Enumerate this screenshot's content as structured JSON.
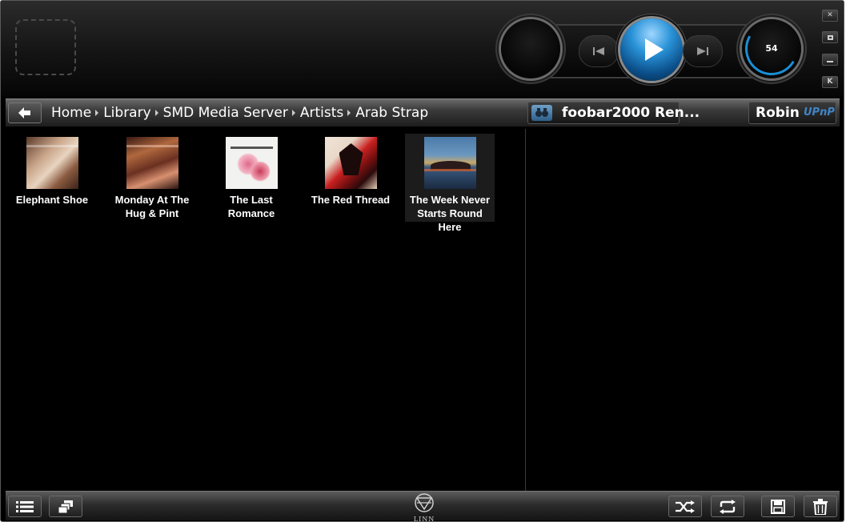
{
  "player": {
    "volume": "54",
    "volume_level_percent": 54
  },
  "breadcrumb": [
    {
      "label": "Home"
    },
    {
      "label": "Library"
    },
    {
      "label": "SMD Media Server"
    },
    {
      "label": "Artists"
    },
    {
      "label": "Arab Strap"
    }
  ],
  "room": {
    "name": "foobar2000 Ren..."
  },
  "source": {
    "name": "Robin",
    "type": "UPnP"
  },
  "albums": [
    {
      "title": "Elephant Shoe"
    },
    {
      "title": "Monday At The Hug & Pint"
    },
    {
      "title": "The Last Romance"
    },
    {
      "title": "The Red Thread"
    },
    {
      "title": "The Week Never Starts Round Here",
      "selected": true
    }
  ],
  "footer": {
    "brand": "LINN"
  },
  "colors": {
    "accent": "#1a8fd6",
    "upnp": "#3f86c8",
    "background": "#000000",
    "text": "#ffffff"
  }
}
